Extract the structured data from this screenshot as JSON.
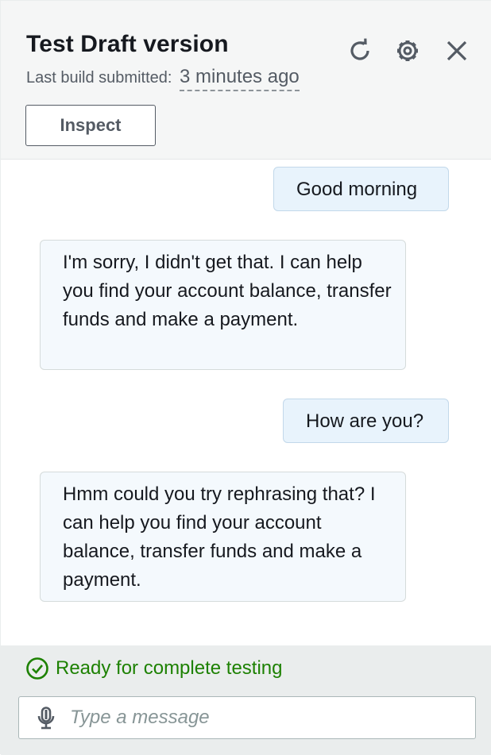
{
  "header": {
    "title": "Test Draft version",
    "build_label": "Last build submitted:",
    "build_time": "3 minutes ago",
    "inspect_label": "Inspect",
    "icons": [
      "refresh-icon",
      "gear-icon",
      "close-icon"
    ]
  },
  "messages": [
    {
      "from": "user",
      "text": "Good morning"
    },
    {
      "from": "bot",
      "text": "I'm sorry, I didn't get that. I can help you find your account balance, transfer funds and make a payment."
    },
    {
      "from": "user",
      "text": "How are you?"
    },
    {
      "from": "bot",
      "text": "Hmm could you try rephrasing that? I can help you find your account balance, transfer funds and make a payment."
    }
  ],
  "status": {
    "text": "Ready for complete testing",
    "color": "#1d8102",
    "icon": "check-circle-icon"
  },
  "composer": {
    "placeholder": "Type a message",
    "value": "",
    "icon": "microphone-icon"
  },
  "colors": {
    "header_bg": "#f5f6f6",
    "user_bubble_bg": "#e8f3fc",
    "bot_bubble_bg": "#f4f9fd",
    "footer_bg": "#eaeded"
  }
}
